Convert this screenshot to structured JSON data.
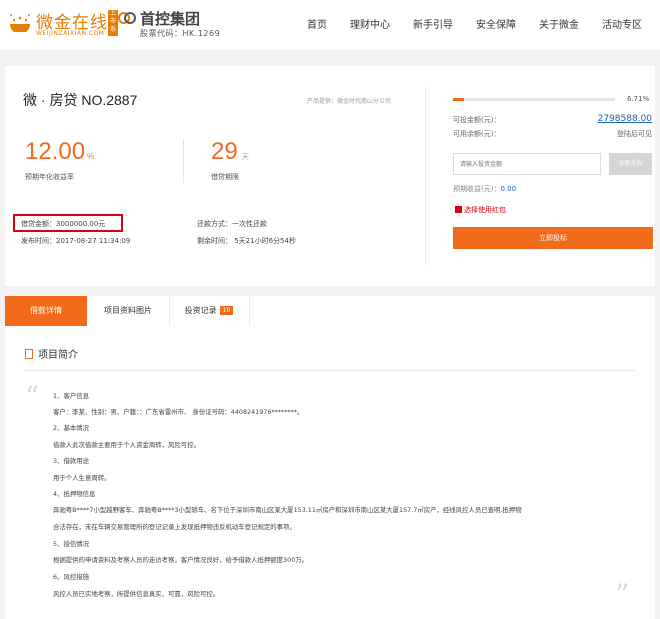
{
  "header": {
    "logo_text": "微金在线",
    "logo_sub": "WEIJINZAIXIAN.COM",
    "logo_badge": "上市系",
    "group_name": "首控集团",
    "group_code": "股票代码：HK.1269",
    "nav": [
      "首页",
      "理财中心",
      "新手引导",
      "安全保障",
      "关于微金",
      "活动专区"
    ]
  },
  "loan": {
    "title": "微 · 房贷 NO.2887",
    "provider": "产品提供：微金时代南山分公司",
    "rate_value": "12.00",
    "rate_unit": "%",
    "rate_label": "预期年化收益率",
    "term_value": "29",
    "term_unit": "天",
    "term_label": "借贷期限",
    "amount": "借贷金额：3000000.00元",
    "publish_time": "发布时间：2017-08-27 11:34:09",
    "repay_method": "还款方式：一次性还款",
    "remaining_time": "剩余时间： 5天21小时6分54秒"
  },
  "invest": {
    "progress_pct_text": "6.71%",
    "progress_fraction": 0.0671,
    "available_label": "可投金额(元)：",
    "available_value": "2798588.00",
    "balance_label": "可用余额(元)：",
    "balance_value": "登陆后可见",
    "input_placeholder": "请输入投资金额",
    "all_button": "余额全投",
    "expected_label": "预期收益(元)：",
    "expected_value": "0.00",
    "redpack": "选择使用红包",
    "invest_button": "立即投标"
  },
  "tabs": {
    "detail": "借款详情",
    "images": "项目资料图片",
    "records": "投资记录",
    "records_count": "10"
  },
  "intro": {
    "heading": "项目简介",
    "lines": [
      "1、客户信息",
      "客户：李某、性别：男、户籍：：广东省雷州市、 身份证号码：4408241976********。",
      "2、基本情况",
      "借款人此次借款主要用于个人资金周转，风险可控。",
      "3、借款用途",
      "用于个人生意周转。",
      "4、抵押物信息",
      "奔驰粤B****7小型越野客车、奔驰粤B****3小型轿车、名下位于深圳市南山区某大厦153.11㎡房产和深圳市南山区某大厦157.7㎡房产，经线风控人员已查明,抵押物",
      "合法存在，未在车辆交易管理所的登记记录上发现抵押物违反机动车登记规定的事项。",
      "5、授信情况",
      "根据提供的申请资料及考察人员的走访考察，客户情况良好，给予借款人抵押额度300万。",
      "6、风控措施",
      "风控人员已实地考察，所提供信息真实、可靠，风险可控。"
    ]
  }
}
